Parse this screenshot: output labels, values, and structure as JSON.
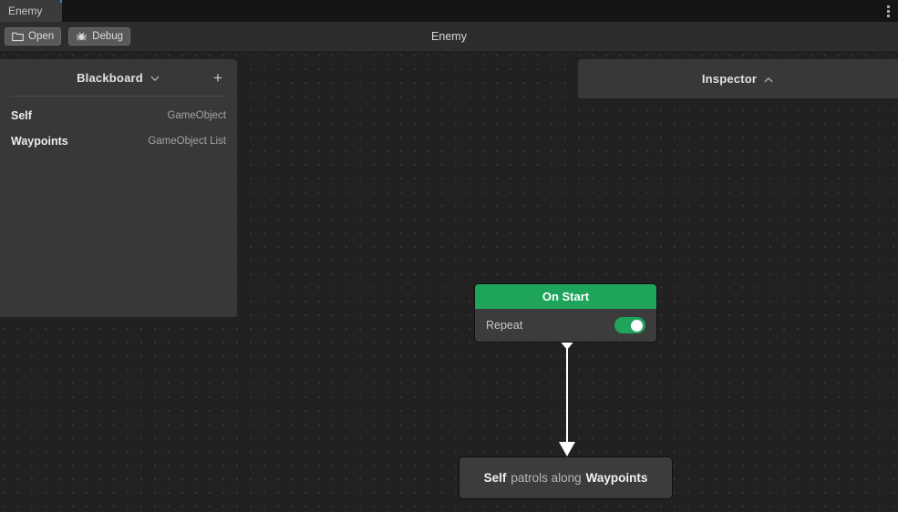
{
  "tabbar": {
    "tabs": [
      {
        "label": "Enemy",
        "active": true
      }
    ],
    "kebab_icon": "kebab-menu-icon"
  },
  "toolbar": {
    "title": "Enemy",
    "buttons": [
      {
        "label": "Open",
        "icon": "folder-icon"
      },
      {
        "label": "Debug",
        "icon": "bug-icon"
      }
    ]
  },
  "blackboard": {
    "title": "Blackboard",
    "collapse_icon": "chevron-down-icon",
    "add_label": "+",
    "rows": [
      {
        "key": "Self",
        "type": "GameObject"
      },
      {
        "key": "Waypoints",
        "type": "GameObject List"
      }
    ]
  },
  "inspector": {
    "title": "Inspector",
    "collapse_icon": "chevron-up-icon"
  },
  "graph": {
    "nodes": [
      {
        "id": "on-start",
        "title": "On Start",
        "header_color": "#1fa45c",
        "properties": [
          {
            "label": "Repeat",
            "type": "toggle",
            "value": true
          }
        ]
      },
      {
        "id": "patrol-action",
        "tokens": [
          {
            "text": "Self",
            "style": "bold"
          },
          {
            "text": "patrols along",
            "style": "normal"
          },
          {
            "text": "Waypoints",
            "style": "bold"
          }
        ]
      }
    ],
    "edges": [
      {
        "from": "on-start",
        "to": "patrol-action",
        "color": "#ffffff"
      }
    ]
  },
  "colors": {
    "accent_green": "#1fa45c",
    "canvas_bg": "#212121",
    "panel_bg": "#383838",
    "node_body": "#3c3c3c",
    "toolbar_bg": "#2d2d2d",
    "tabbar_bg": "#151515"
  }
}
